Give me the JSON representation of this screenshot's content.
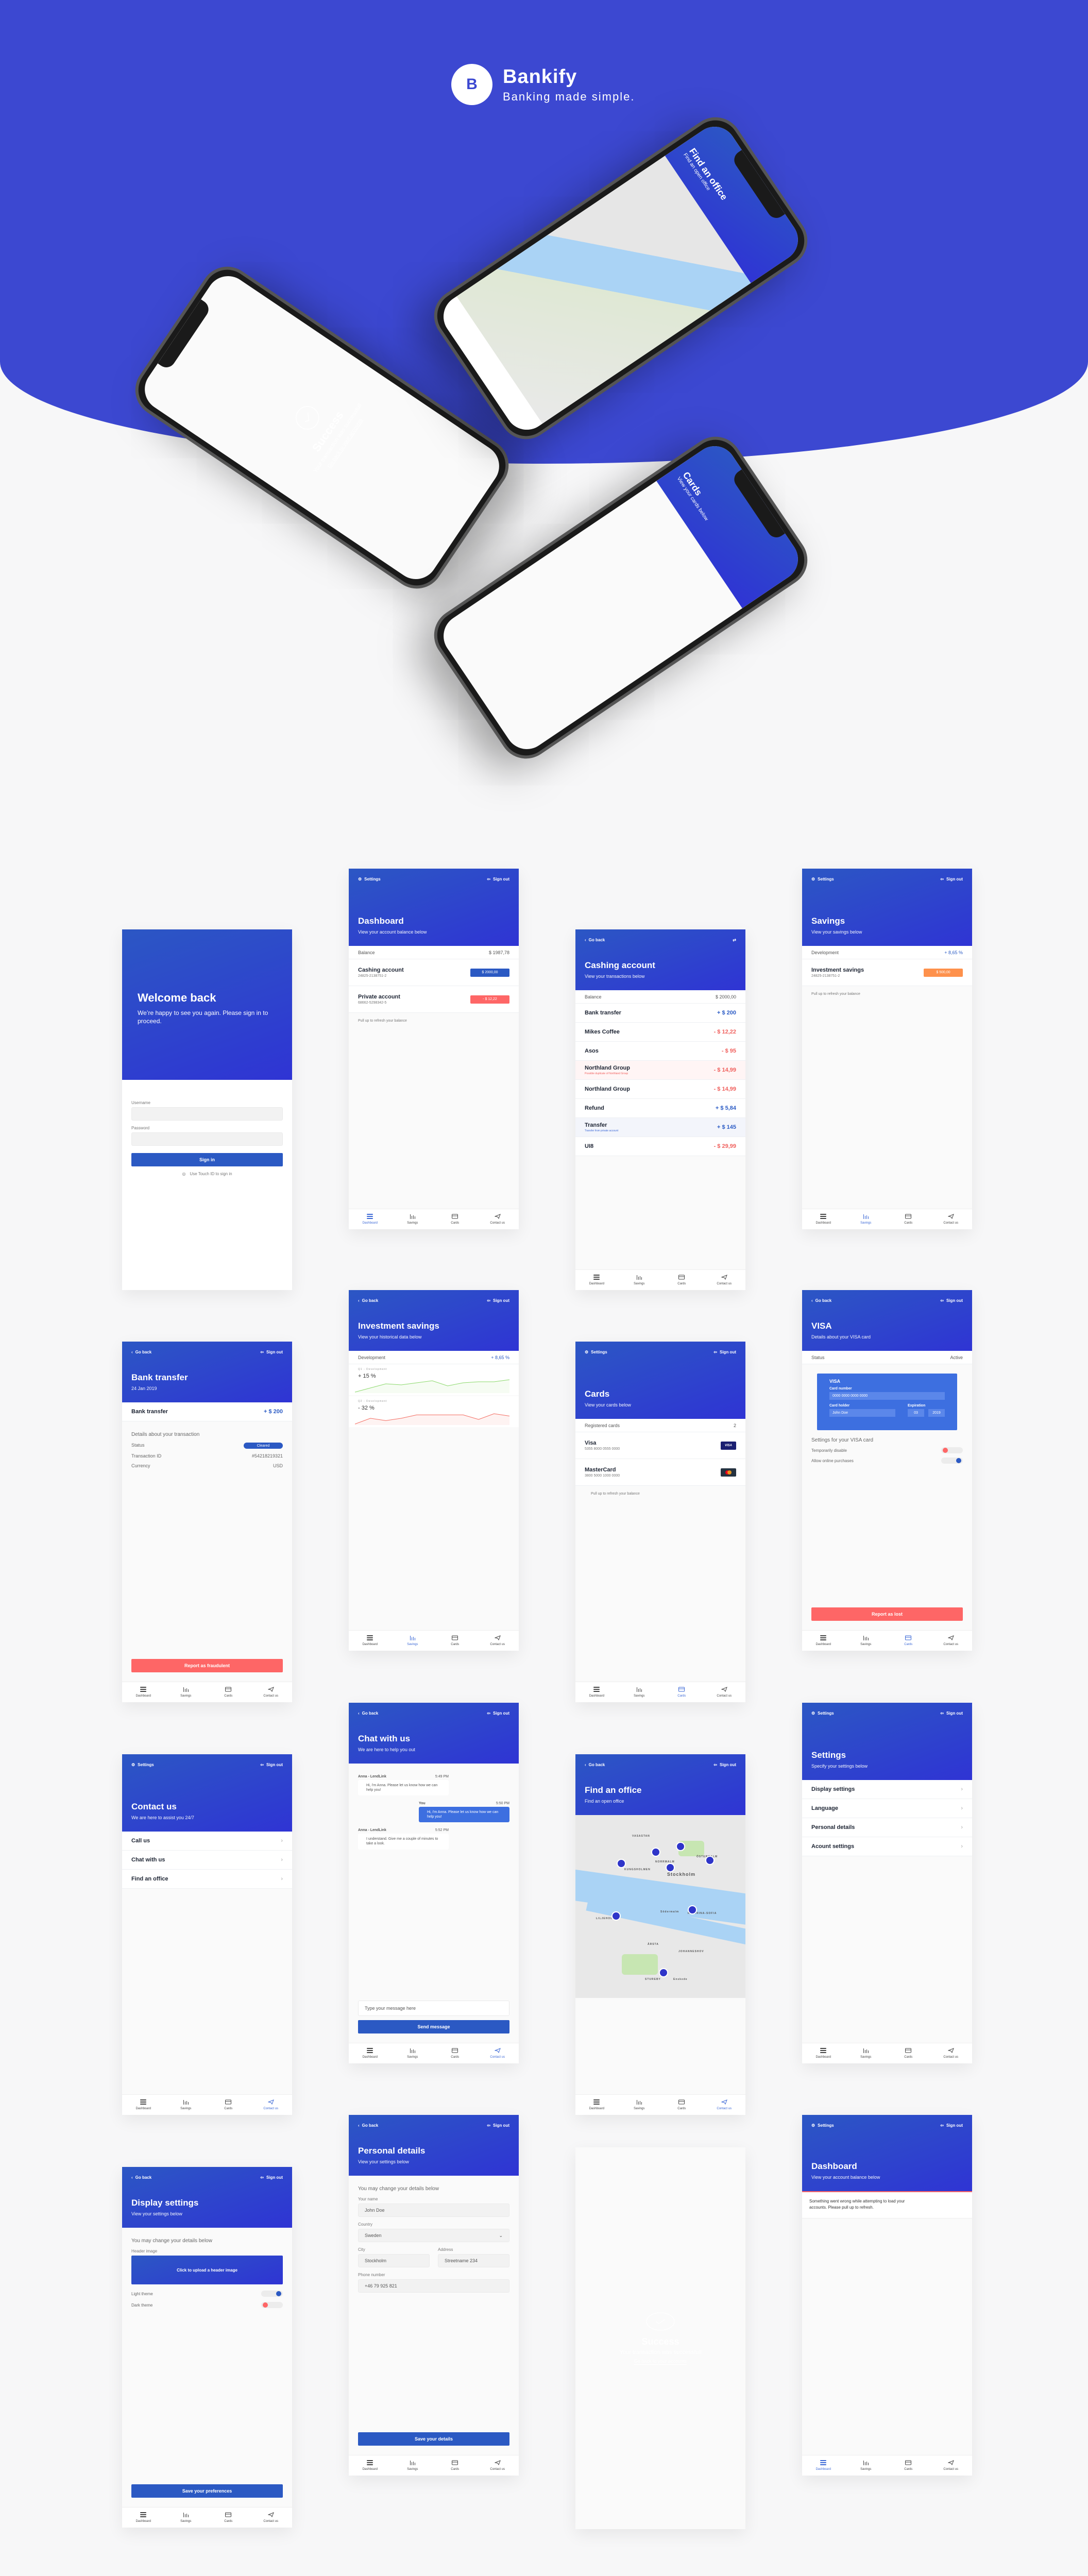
{
  "brand": {
    "logo_letter": "B",
    "name": "Bankify",
    "tagline": "Banking made simple."
  },
  "colors": {
    "primary": "#2f34d4",
    "accent_blue": "#2b59c3",
    "danger": "#fe6666",
    "orange": "#fe914c",
    "hero_bg": "#3c48d1"
  },
  "common": {
    "settings": "Settings",
    "sign_out": "Sign out",
    "go_back": "Go back",
    "pull_refresh": "Pull up to refresh your balance",
    "nav": [
      "Dashboard",
      "Savings",
      "Cards",
      "Contact us"
    ]
  },
  "mockups": {
    "success": {
      "title": "Success",
      "text": "Your transaction was successfull",
      "link": "Go back to your accounts"
    },
    "map": {
      "title": "Find an office",
      "subtitle": "Find an open office"
    },
    "cards": {
      "title": "Cards",
      "subtitle": "View your cards below"
    }
  },
  "login": {
    "title": "Welcome back",
    "subtitle": "We’re happy to see you again. Please sign in to proceed.",
    "username_label": "Username",
    "password_label": "Password",
    "sign_in": "Sign in",
    "touch_id": "Use Touch ID to sign in"
  },
  "dashboard": {
    "title": "Dashboard",
    "subtitle": "View your account balance below",
    "balance_label": "Balance",
    "balance": "$ 1987,78",
    "accounts": [
      {
        "name": "Cashing account",
        "number": "24825-2138751-2",
        "amount": "$ 2000,00"
      },
      {
        "name": "Private account",
        "number": "68662-5298342-5",
        "amount": "- $ 12,22"
      }
    ]
  },
  "cashing": {
    "title": "Cashing account",
    "subtitle": "View your transactions below",
    "balance_label": "Balance",
    "balance": "$ 2000,00",
    "transactions": [
      {
        "name": "Bank transfer",
        "note": "",
        "amount": "+ $ 200",
        "type": "pos"
      },
      {
        "name": "Mikes Coffee",
        "note": "",
        "amount": "- $ 12,22",
        "type": "neg"
      },
      {
        "name": "Asos",
        "note": "",
        "amount": "- $ 95",
        "type": "neg"
      },
      {
        "name": "Northland Group",
        "note": "Possible duplicate of Northland Group",
        "amount": "- $ 14,99",
        "type": "neg"
      },
      {
        "name": "Northland Group",
        "note": "",
        "amount": "- $ 14,99",
        "type": "neg"
      },
      {
        "name": "Refund",
        "note": "",
        "amount": "+ $ 5,84",
        "type": "pos"
      },
      {
        "name": "Transfer",
        "note": "Transfer from private account",
        "amount": "+ $ 145",
        "type": "pos"
      },
      {
        "name": "UI8",
        "note": "",
        "amount": "- $ 29,99",
        "type": "neg"
      }
    ]
  },
  "savings": {
    "title": "Savings",
    "subtitle": "View your savings below",
    "dev_label": "Development",
    "dev_value": "+ 8,65 %",
    "account": {
      "name": "Investment savings",
      "number": "24825-2138751-2",
      "amount": "$ 500,00"
    }
  },
  "bank_transfer": {
    "title": "Bank transfer",
    "date": "24 Jan 2019",
    "name": "Bank transfer",
    "amount": "+ $ 200",
    "details_title": "Details about your transaction",
    "status_label": "Status",
    "status": "Cleared",
    "txid_label": "Transaction ID",
    "txid": "#54218219321",
    "currency_label": "Currency",
    "currency": "USD",
    "report": "Report as fraudulent"
  },
  "investment": {
    "title": "Investment savings",
    "subtitle": "View your historical data below",
    "dev_label": "Development",
    "dev_value": "+ 8,65 %",
    "q1_label": "Q1 - Development",
    "q1_value": "+ 15 %",
    "q2_label": "Q2 - Development",
    "q2_value": "- 32 %"
  },
  "chart_data": [
    {
      "type": "line",
      "title": "Q1 - Development",
      "series": [
        {
          "name": "Q1",
          "color": "#8ad86a",
          "values": [
            0,
            4,
            8,
            7,
            9,
            11,
            6,
            9,
            10,
            10,
            12
          ]
        }
      ]
    },
    {
      "type": "line",
      "title": "Q2 - Development",
      "series": [
        {
          "name": "Q2",
          "color": "#f36a5f",
          "values": [
            0,
            5,
            3,
            5,
            8,
            8,
            8,
            8,
            4,
            9,
            7
          ]
        }
      ]
    }
  ],
  "cards": {
    "title": "Cards",
    "subtitle": "View your cards below",
    "registered_label": "Registered cards",
    "registered_count": "2",
    "list": [
      {
        "name": "Visa",
        "number": "5355 8000 0555 0000",
        "brand": "VISA"
      },
      {
        "name": "MasterCard",
        "number": "3800 5000 1000 0000",
        "brand": "mastercard"
      }
    ]
  },
  "visa": {
    "title": "VISA",
    "subtitle": "Details about your VISA card",
    "status_label": "Status",
    "status": "Active",
    "card_brand": "VISA",
    "card_number_label": "Card number",
    "card_number": "0000 0000 0000 0000",
    "holder_label": "Card holder",
    "holder": "John Doe",
    "exp_label": "Expiration",
    "exp_month": "03",
    "exp_year": "2019",
    "settings_title": "Settings for your VISA card",
    "toggle1": "Temporarily disable",
    "toggle2": "Allow online purchases",
    "report": "Report as lost"
  },
  "contact": {
    "title": "Contact us",
    "subtitle": "We are here to assist you 24/7",
    "items": [
      "Call us",
      "Chat with us",
      "Find an office"
    ]
  },
  "chat": {
    "title": "Chat with us",
    "subtitle": "We are here to help you out",
    "messages": [
      {
        "from": "Anna - LendLink",
        "time": "5:49 PM",
        "text": "Hi, i'm Anna. Please let us know how we can help you!",
        "me": false
      },
      {
        "from": "You",
        "time": "5:50 PM",
        "text": "Hi, i'm Anna. Please let us know how we can help you!",
        "me": true
      },
      {
        "from": "Anna - LendLink",
        "time": "5:52 PM",
        "text": "I understand. Give me a couple of minutes to take a look.",
        "me": false
      }
    ],
    "placeholder": "Type your message here",
    "send": "Send message"
  },
  "office": {
    "title": "Find an office",
    "subtitle": "Find an open office",
    "map_labels": [
      "VASASTAN",
      "NORRMALM",
      "Stockholm",
      "ÖSTERMALM",
      "KUNGSHOLMEN",
      "Södermalm",
      "KATARINA-SOFIA",
      "LILJEHOLMEN",
      "ÅRSTA",
      "JOHANNESHOV",
      "STUREBY",
      "Enskede"
    ]
  },
  "settings": {
    "title": "Settings",
    "subtitle": "Specify your settings below",
    "items": [
      "Display settings",
      "Language",
      "Personal details",
      "Acount settings"
    ]
  },
  "display": {
    "title": "Display settings",
    "subtitle": "View your settings below",
    "intro": "You may change your details below",
    "header_label": "Header image",
    "upload": "Click to upload a header image",
    "light": "Light theme",
    "dark": "Dark theme",
    "save": "Save your preferences"
  },
  "personal": {
    "title": "Personal details",
    "subtitle": "View your settings below",
    "intro": "You may change your details below",
    "name_label": "Your name",
    "name": "John Doe",
    "country_label": "Country",
    "country": "Sweden",
    "city_label": "City",
    "city": "Stockholm",
    "address_label": "Address",
    "address": "Streetname 234",
    "phone_label": "Phone number",
    "phone": "+46 79 925 821",
    "save": "Save your details"
  },
  "success": {
    "title": "Success",
    "text": "Your transaction was successfull",
    "link": "Go back to your accounts"
  },
  "dash_error": {
    "title": "Dashboard",
    "subtitle": "View your account balance below",
    "error": "Something went wrong while attempting to load your accounts. Please pull up to refresh."
  }
}
